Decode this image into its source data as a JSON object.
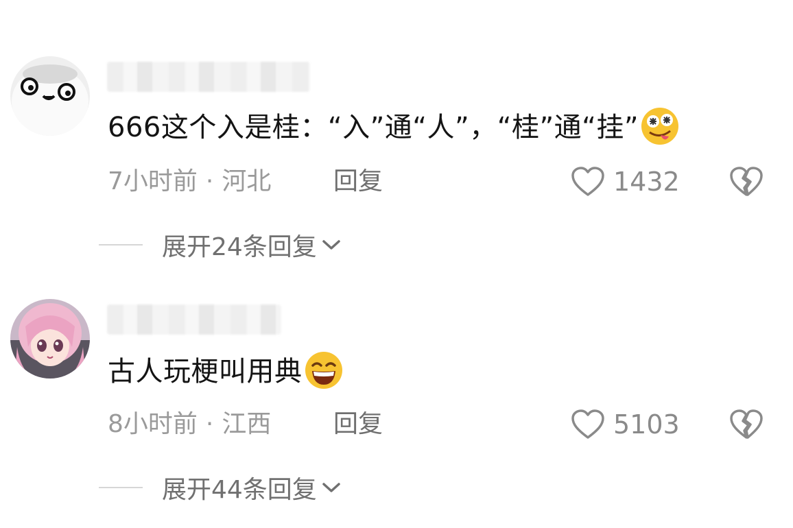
{
  "comments": [
    {
      "avatar_icon": "cartoon-face-avatar",
      "text": "666这个入是桂：“入”通“人”，“桂”通“挂”",
      "emoji": "dizzy-tongue-emoji",
      "time": "7小时前",
      "separator": "·",
      "location": "河北",
      "reply_label": "回复",
      "like_count": "1432",
      "expand_label": "展开24条回复"
    },
    {
      "avatar_icon": "anime-girl-avatar",
      "text": "古人玩梗叫用典",
      "emoji": "grinning-face-emoji",
      "time": "8小时前",
      "separator": "·",
      "location": "江西",
      "reply_label": "回复",
      "like_count": "5103",
      "expand_label": "展开44条回复"
    }
  ],
  "colors": {
    "text": "#141414",
    "meta": "#9a9a9a",
    "icon": "#8a8a8a",
    "emoji_yellow": "#f7c331"
  }
}
